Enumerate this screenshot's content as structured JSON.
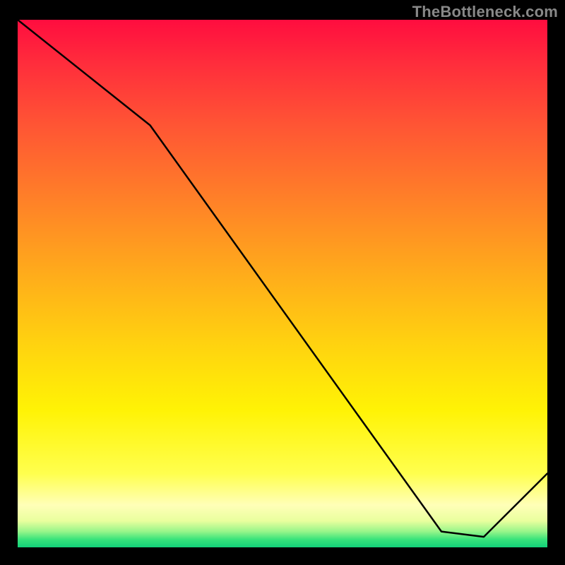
{
  "attribution": "TheBottleneck.com",
  "annotation_label": "",
  "chart_data": {
    "type": "line",
    "title": "",
    "xlabel": "",
    "ylabel": "",
    "xlim": [
      0,
      100
    ],
    "ylim": [
      0,
      100
    ],
    "series": [
      {
        "name": "curve",
        "x": [
          0,
          25,
          80,
          88,
          100
        ],
        "y": [
          100,
          80,
          3,
          2,
          14
        ]
      }
    ],
    "annotations": [
      {
        "x": 83,
        "y": 3.5,
        "text": ""
      }
    ],
    "background_gradient": {
      "direction": "vertical",
      "stops": [
        {
          "pos": 0.0,
          "color": "#ff0d3f"
        },
        {
          "pos": 0.5,
          "color": "#ffcc10"
        },
        {
          "pos": 0.88,
          "color": "#ffff66"
        },
        {
          "pos": 1.0,
          "color": "#12d17a"
        }
      ]
    }
  }
}
